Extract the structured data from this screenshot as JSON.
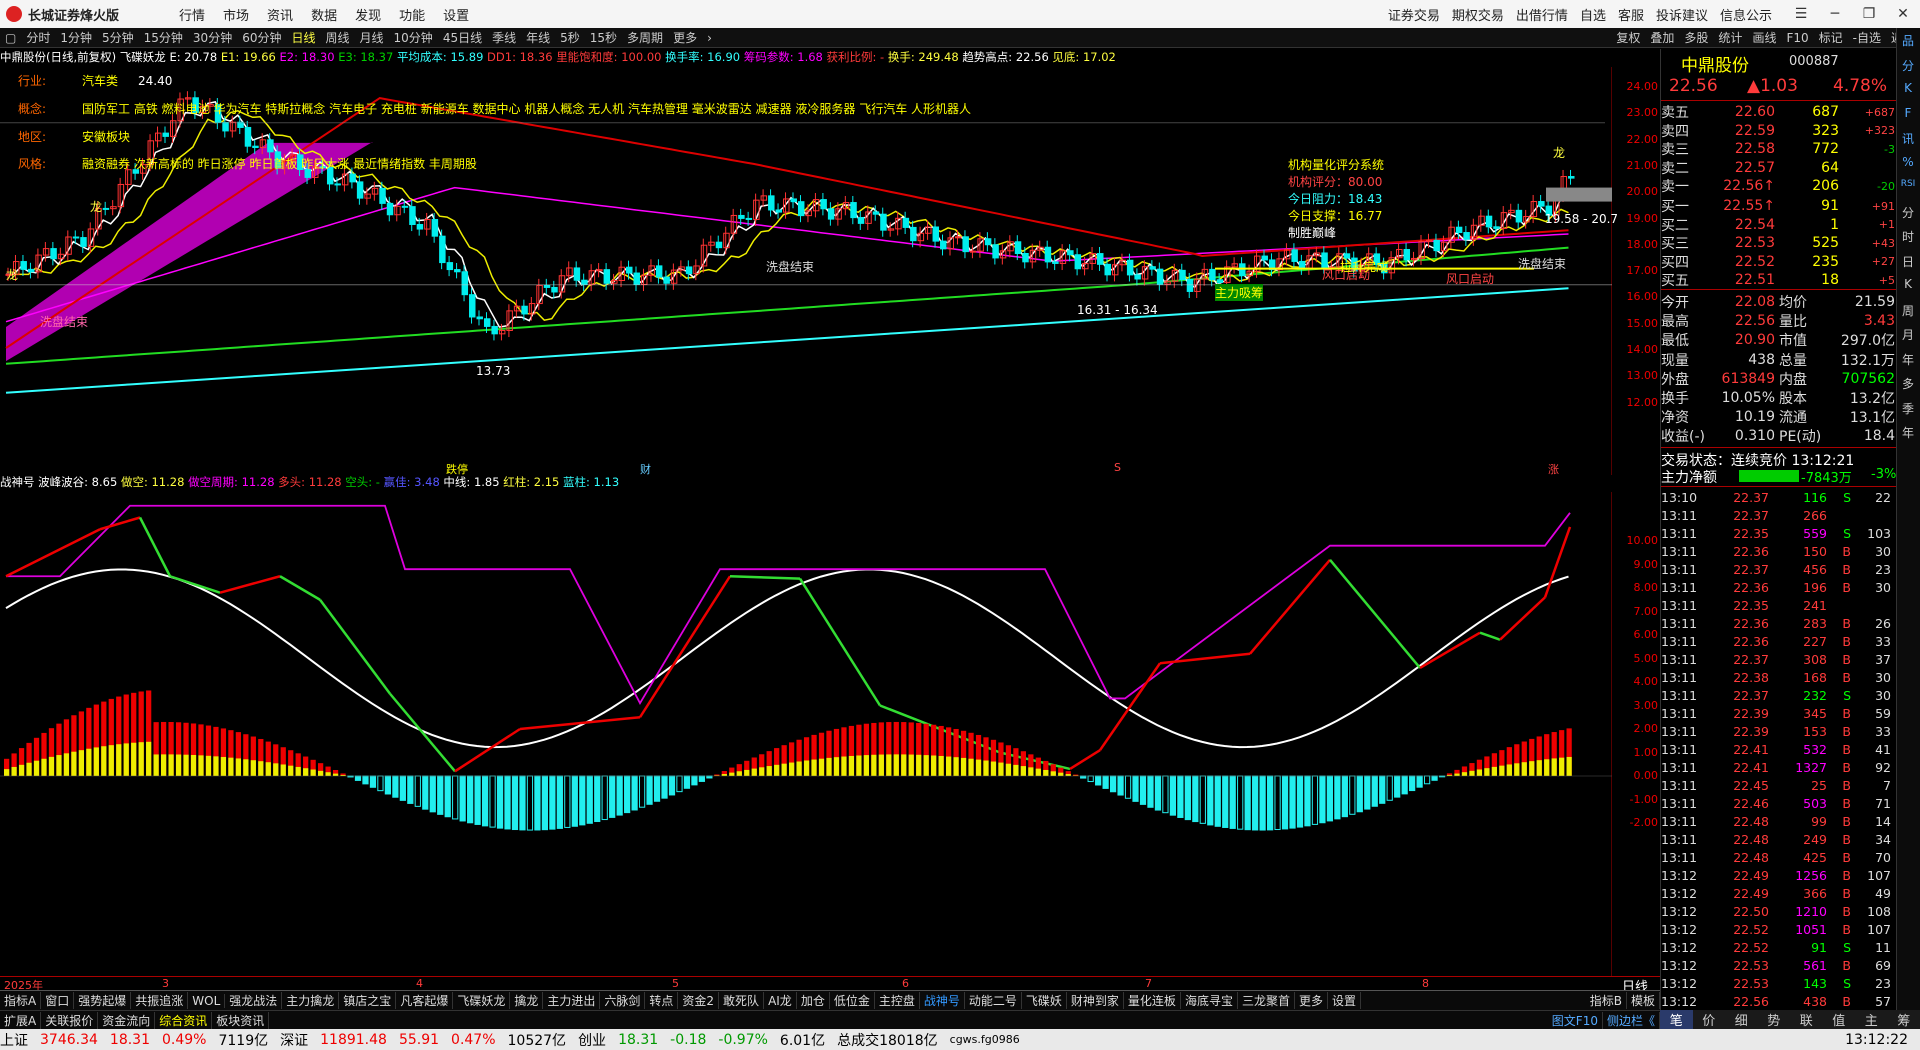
{
  "app": {
    "name": "长城证券烽火版",
    "menu": [
      "行情",
      "市场",
      "资讯",
      "数据",
      "发现",
      "功能",
      "设置"
    ],
    "right_menu": [
      "证券交易",
      "期权交易",
      "出借行情",
      "自选",
      "客服",
      "投诉建议",
      "信息公示"
    ]
  },
  "periods": [
    "分时",
    "1分钟",
    "5分钟",
    "15分钟",
    "30分钟",
    "60分钟",
    "日线",
    "周线",
    "月线",
    "10分钟",
    "45日线",
    "季线",
    "年线",
    "5秒",
    "15秒",
    "多周期",
    "更多"
  ],
  "selected_period": "日线",
  "toolbar": [
    "复权",
    "叠加",
    "多股",
    "统计",
    "画线",
    "F10",
    "标记",
    "-自选",
    "返回"
  ],
  "indicator1": {
    "stock": "中鼎股份(日线,前复权)",
    "name": "飞碟妖龙",
    "e": "E: 20.78",
    "e1": "E1: 19.66",
    "e2": "E2: 18.30",
    "e3": "E3: 18.37",
    "avgcost": "平均成本: 15.89",
    "dd1": "DD1: 18.36",
    "dense": "里能饱和度: 100.00",
    "turnover": "换手率: 16.90",
    "chip": "筹码参数: 1.68",
    "profit": "获利比例: -",
    "huanshou": "换手: 249.48",
    "trend": "趋势高点: 22.56",
    "top": "见底: 17.02"
  },
  "info": {
    "industry_label": "行业:",
    "industry": "汽车类",
    "concept_label": "概念:",
    "concept": "国防军工 高铁 燃料电池 华为汽车 特斯拉概念 汽车电子 充电桩 新能源车 数据中心 机器人概念 无人机 汽车热管理 毫米波雷达 减速器 液冷服务器 飞行汽车 人形机器人",
    "region_label": "地区:",
    "region": "安徽板块",
    "style_label": "风格:",
    "style": "融资融券 次新高标的 昨日涨停 昨日首板 昨日大涨 最近情绪指数 丰周期股"
  },
  "annotations": {
    "high": "24.40",
    "low": "13.73",
    "range": "16.31 - 16.34",
    "wash1": "洗盘结束",
    "wash2": "洗盘结束",
    "wash3": "洗盘结束",
    "main": "主力吸筹",
    "risk": "风口启动",
    "pull": "拉升完成",
    "fengkou": "风口启动",
    "long1": "龙",
    "long2": "龙",
    "long3": "龙",
    "long4": "龙",
    "partial": "19.58 - 20.7",
    "tiejin": "跌停",
    "cai": "财",
    "zhang": "涨",
    "s": "S"
  },
  "quant": {
    "title": "机构量化评分系统",
    "score": "机构评分：80.00",
    "resist": "今日阻力：18.43",
    "support": "今日支撑：16.77",
    "peak": "制胜巅峰"
  },
  "price_axis": [
    "24.00",
    "23.00",
    "22.00",
    "21.00",
    "20.00",
    "19.00",
    "18.00",
    "17.00",
    "16.00",
    "15.00",
    "14.00",
    "13.00",
    "12.00"
  ],
  "indicator2": {
    "name": "战神号",
    "wave": "波峰波谷: 8.65",
    "weak": "做空: 11.28",
    "weak_cycle": "做空周期: 11.28",
    "long": "多头: 11.28",
    "short": "空头: -",
    "gold": "赢佳: 3.48",
    "mid": "中线: 1.85",
    "red": "红柱: 2.15",
    "blue": "蓝柱: 1.13"
  },
  "sub_axis": [
    "10.00",
    "9.00",
    "8.00",
    "7.00",
    "6.00",
    "5.00",
    "4.00",
    "3.00",
    "2.00",
    "1.00",
    "0.00",
    "-1.00",
    "-2.00"
  ],
  "dates": {
    "y": "2025年",
    "m3": "3",
    "m4": "4",
    "m5": "5",
    "m6": "6",
    "m7": "7",
    "m8": "8",
    "period_btn": "日线"
  },
  "quote": {
    "name": "中鼎股份",
    "code": "000887",
    "price": "22.56",
    "change": "▲1.03",
    "pct": "4.78%",
    "asks": [
      {
        "l": "卖五",
        "p": "22.60",
        "v": "687",
        "d": "+687"
      },
      {
        "l": "卖四",
        "p": "22.59",
        "v": "323",
        "d": "+323"
      },
      {
        "l": "卖三",
        "p": "22.58",
        "v": "772",
        "d": "-3"
      },
      {
        "l": "卖二",
        "p": "22.57",
        "v": "64",
        "d": ""
      },
      {
        "l": "卖一",
        "p": "22.56↑",
        "v": "206",
        "d": "-20"
      }
    ],
    "bids": [
      {
        "l": "买一",
        "p": "22.55↑",
        "v": "91",
        "d": "+91"
      },
      {
        "l": "买二",
        "p": "22.54",
        "v": "1",
        "d": "+1"
      },
      {
        "l": "买三",
        "p": "22.53",
        "v": "525",
        "d": "+43"
      },
      {
        "l": "买四",
        "p": "22.52",
        "v": "235",
        "d": "+27"
      },
      {
        "l": "买五",
        "p": "22.51",
        "v": "18",
        "d": "+5"
      }
    ],
    "stats": [
      [
        "今开",
        "22.08",
        "均价",
        "21.59"
      ],
      [
        "最高",
        "22.56",
        "量比",
        "3.43"
      ],
      [
        "最低",
        "20.90",
        "市值",
        "297.0亿"
      ],
      [
        "现量",
        "438",
        "总量",
        "132.1万"
      ],
      [
        "外盘",
        "613849",
        "内盘",
        "707562"
      ],
      [
        "换手",
        "10.05%",
        "股本",
        "13.2亿"
      ],
      [
        "净资",
        "10.19",
        "流通",
        "13.1亿"
      ],
      [
        "收益(-)",
        "0.310",
        "PE(动)",
        "18.4"
      ]
    ],
    "trade_state": "交易状态：连续竞价 13:12:21",
    "main_label": "主力净额",
    "main_val": "-7843万",
    "main_pct": "-3%"
  },
  "ticks": [
    [
      "13:10",
      "22.37",
      "116",
      "S",
      "22"
    ],
    [
      "13:11",
      "22.37",
      "266",
      "",
      ""
    ],
    [
      "13:11",
      "22.35",
      "559",
      "S",
      "103"
    ],
    [
      "13:11",
      "22.36",
      "150",
      "B",
      "30"
    ],
    [
      "13:11",
      "22.37",
      "456",
      "B",
      "23"
    ],
    [
      "13:11",
      "22.36",
      "196",
      "B",
      "30"
    ],
    [
      "13:11",
      "22.35",
      "241",
      "",
      ""
    ],
    [
      "13:11",
      "22.36",
      "283",
      "B",
      "26"
    ],
    [
      "13:11",
      "22.36",
      "227",
      "B",
      "33"
    ],
    [
      "13:11",
      "22.37",
      "308",
      "B",
      "37"
    ],
    [
      "13:11",
      "22.38",
      "168",
      "B",
      "30"
    ],
    [
      "13:11",
      "22.37",
      "232",
      "S",
      "30"
    ],
    [
      "13:11",
      "22.39",
      "345",
      "B",
      "59"
    ],
    [
      "13:11",
      "22.39",
      "153",
      "B",
      "33"
    ],
    [
      "13:11",
      "22.41",
      "532",
      "B",
      "41"
    ],
    [
      "13:11",
      "22.41",
      "1327",
      "B",
      "92"
    ],
    [
      "13:11",
      "22.45",
      "25",
      "B",
      "7"
    ],
    [
      "13:11",
      "22.46",
      "503",
      "B",
      "71"
    ],
    [
      "13:11",
      "22.48",
      "99",
      "B",
      "14"
    ],
    [
      "13:11",
      "22.48",
      "249",
      "B",
      "34"
    ],
    [
      "13:11",
      "22.48",
      "425",
      "B",
      "70"
    ],
    [
      "13:12",
      "22.49",
      "1256",
      "B",
      "107"
    ],
    [
      "13:12",
      "22.49",
      "366",
      "B",
      "49"
    ],
    [
      "13:12",
      "22.50",
      "1210",
      "B",
      "108"
    ],
    [
      "13:12",
      "22.52",
      "1051",
      "B",
      "107"
    ],
    [
      "13:12",
      "22.52",
      "91",
      "S",
      "11"
    ],
    [
      "13:12",
      "22.53",
      "561",
      "B",
      "69"
    ],
    [
      "13:12",
      "22.53",
      "143",
      "S",
      "23"
    ],
    [
      "13:12",
      "22.56",
      "438",
      "B",
      "57"
    ]
  ],
  "bottom_tabs": [
    "指标A",
    "窗口",
    "强势起爆",
    "共振追涨",
    "WOL",
    "强龙战法",
    "主力擒龙",
    "镇店之宝",
    "凡客起爆",
    "飞碟妖龙",
    "擒龙",
    "主力进出",
    "六脉剑",
    "转点",
    "资金2",
    "敢死队",
    "AI龙",
    "加仓",
    "低位金",
    "主控盘",
    "战神号",
    "动能二号",
    "飞碟妖",
    "财神到家",
    "量化连板",
    "海底寻宝",
    "三龙聚首",
    "更多",
    "设置"
  ],
  "selected_tab": "战神号",
  "bottom_right": [
    "指标B",
    "模板"
  ],
  "bottom_tabs2": [
    "扩展A",
    "关联报价",
    "资金流向",
    "综合资讯",
    "板块资讯"
  ],
  "bottom_tabs2_right": [
    "图文F10",
    "侧边栏《"
  ],
  "right_tabs": [
    "笔",
    "价",
    "细",
    "势",
    "联",
    "值",
    "主",
    "筹"
  ],
  "status": {
    "sh_label": "上证",
    "sh": "3746.34",
    "sh_chg": "18.31",
    "sh_pct": "0.49%",
    "sh_amt": "7119亿",
    "sz_label": "深证",
    "sz": "11891.48",
    "sz_chg": "55.91",
    "sz_pct": "0.47%",
    "sz_amt": "10527亿",
    "cy_label": "创业",
    "cy": "18.31",
    "cy_chg": "-0.18",
    "cy_pct": "-0.97%",
    "cy_amt": "6.01亿",
    "total": "总成交18018亿",
    "server": "cgws.fg0986",
    "time": "13:12:22"
  },
  "side_icons": [
    "品",
    "分",
    "K",
    "F",
    "讯",
    "%",
    "RSI",
    "分",
    "时",
    "日",
    "K",
    "周",
    "月",
    "年",
    "多",
    "季",
    "年"
  ]
}
